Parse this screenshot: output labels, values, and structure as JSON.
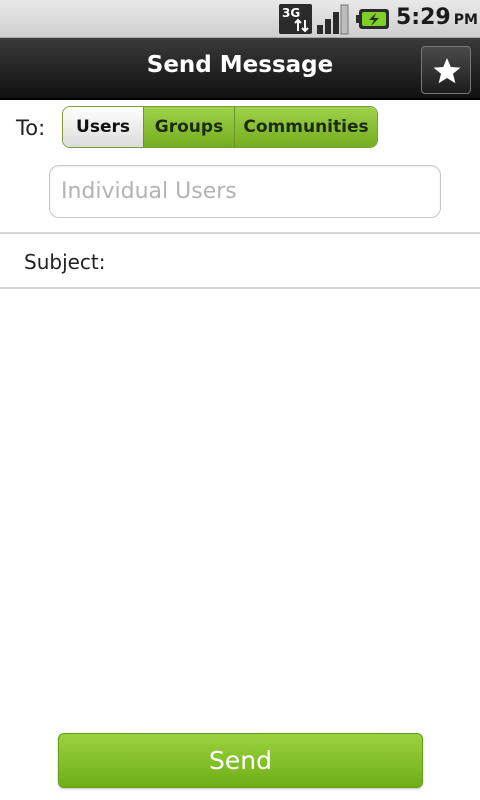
{
  "status_bar": {
    "network_icon": "3g-data-icon",
    "signal_icon": "signal-strength-icon",
    "battery_icon": "battery-charging-icon",
    "time": "5:29",
    "ampm": "PM"
  },
  "title_bar": {
    "title": "Send Message",
    "action_icon": "star-icon"
  },
  "recipients": {
    "to_label": "To:",
    "tabs": [
      {
        "label": "Users",
        "selected": true
      },
      {
        "label": "Groups",
        "selected": false
      },
      {
        "label": "Communities",
        "selected": false
      }
    ],
    "input_placeholder": "Individual Users",
    "input_value": ""
  },
  "subject": {
    "label": "Subject:",
    "value": ""
  },
  "message_body": {
    "value": ""
  },
  "send_button": {
    "label": "Send"
  },
  "colors": {
    "accent_green": "#7fbf26",
    "title_bar": "#1a1a1a"
  }
}
